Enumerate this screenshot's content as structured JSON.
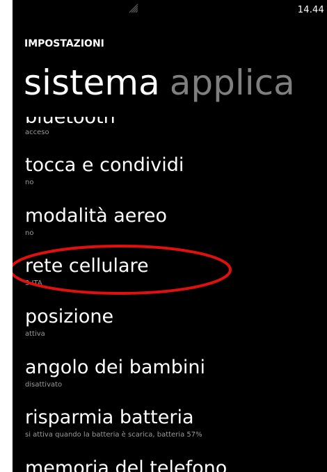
{
  "status_bar": {
    "time": "14.44",
    "signal_icon": "signal-strength-icon"
  },
  "header": {
    "section_title": "IMPOSTAZIONI",
    "pivot_active": "sistema",
    "pivot_next": "applica"
  },
  "settings": [
    {
      "title": "bluetooth",
      "subtitle": "acceso"
    },
    {
      "title": "tocca e condividi",
      "subtitle": "no"
    },
    {
      "title": "modalità aereo",
      "subtitle": "no"
    },
    {
      "title": "rete cellulare",
      "subtitle": "3 ITA"
    },
    {
      "title": "posizione",
      "subtitle": "attiva"
    },
    {
      "title": "angolo dei bambini",
      "subtitle": "disattivato"
    },
    {
      "title": "risparmia batteria",
      "subtitle": "si attiva quando la batteria è scarica, batteria 57%"
    },
    {
      "title": "memoria del telefono",
      "subtitle": ""
    }
  ],
  "colors": {
    "background": "#000000",
    "text": "#ffffff",
    "subtext": "#9a9a9a",
    "pivot_inactive": "#7f7f7f",
    "highlight": "#e01010"
  }
}
